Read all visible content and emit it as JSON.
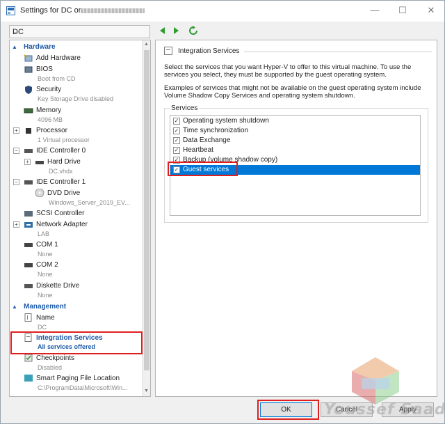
{
  "window": {
    "title": "Settings for DC on"
  },
  "vm_selector": {
    "value": "DC"
  },
  "sidebar": {
    "hardware_label": "Hardware",
    "management_label": "Management",
    "hardware_items": [
      {
        "name": "Add Hardware",
        "sub": ""
      },
      {
        "name": "BIOS",
        "sub": "Boot from CD"
      },
      {
        "name": "Security",
        "sub": "Key Storage Drive disabled"
      },
      {
        "name": "Memory",
        "sub": "4096 MB"
      },
      {
        "name": "Processor",
        "sub": "1 Virtual processor"
      },
      {
        "name": "IDE Controller 0",
        "sub": ""
      },
      {
        "name": "Hard Drive",
        "sub": "DC.vhdx"
      },
      {
        "name": "IDE Controller 1",
        "sub": ""
      },
      {
        "name": "DVD Drive",
        "sub": "Windows_Server_2019_EV..."
      },
      {
        "name": "SCSI Controller",
        "sub": ""
      },
      {
        "name": "Network Adapter",
        "sub": "LAB"
      },
      {
        "name": "COM 1",
        "sub": "None"
      },
      {
        "name": "COM 2",
        "sub": "None"
      },
      {
        "name": "Diskette Drive",
        "sub": "None"
      }
    ],
    "management_items": [
      {
        "name": "Name",
        "sub": "DC"
      },
      {
        "name": "Integration Services",
        "sub": "All services offered"
      },
      {
        "name": "Checkpoints",
        "sub": "Disabled"
      },
      {
        "name": "Smart Paging File Location",
        "sub": "C:\\ProgramData\\Microsoft\\Win..."
      }
    ]
  },
  "main": {
    "group_title": "Integration Services",
    "desc1": "Select the services that you want Hyper-V to offer to this virtual machine. To use the services you select, they must be supported by the guest operating system.",
    "desc2": "Examples of services that might not be available on the guest operating system include Volume Shadow Copy Services and operating system shutdown.",
    "services_label": "Services",
    "services": [
      {
        "label": "Operating system shutdown",
        "checked": true
      },
      {
        "label": "Time synchronization",
        "checked": true
      },
      {
        "label": "Data Exchange",
        "checked": true
      },
      {
        "label": "Heartbeat",
        "checked": true
      },
      {
        "label": "Backup (volume shadow copy)",
        "checked": true
      },
      {
        "label": "Guest services",
        "checked": true
      }
    ]
  },
  "buttons": {
    "ok": "OK",
    "cancel": "Cancel",
    "apply": "Apply"
  },
  "watermark": "Youssef Saad",
  "colors": {
    "accent": "#1e5aa8",
    "selection": "#0078d7",
    "highlight_box": "#e01e1e"
  }
}
